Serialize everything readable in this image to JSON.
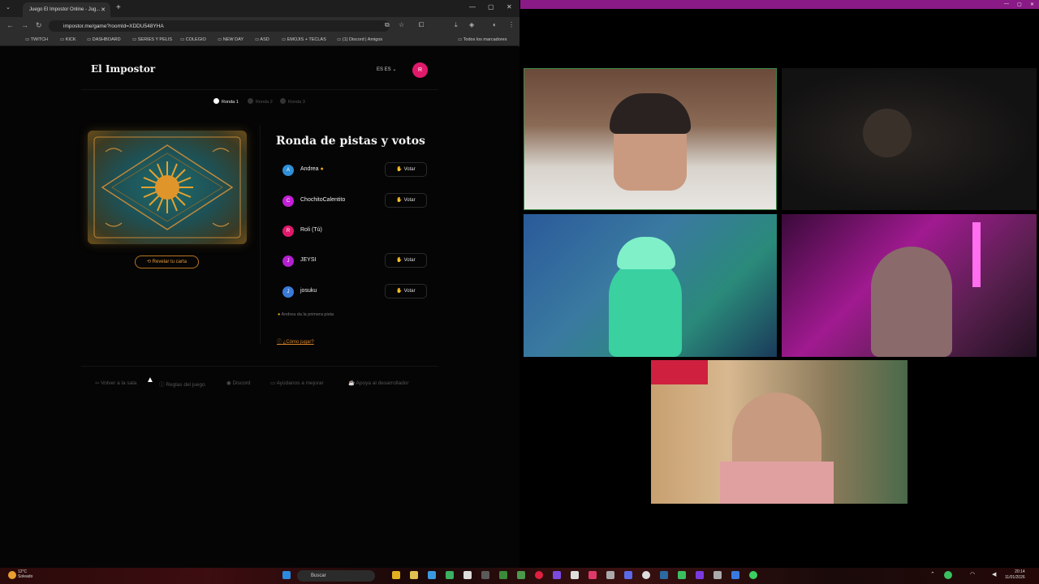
{
  "browser": {
    "tab_title": "Juego El Impostor Online - Jug...",
    "url": "impostor.me/game?roomId=XDDU548YHA",
    "bookmarks": [
      "TWITCH",
      "KICK",
      "DASHBOARD",
      "SERIES Y PELIS",
      "COLEGIO",
      "NEW DAY",
      "ASD",
      "EMOJIS + TECLAS",
      "(1) Discord | Amigos",
      "Todos los marcadores"
    ]
  },
  "app": {
    "logo": "El Impostor",
    "lang": "ES ES",
    "avatar_initial": "R",
    "rounds": [
      "Ronda 1",
      "Ronda 2",
      "Ronda 3"
    ],
    "reveal_label": "Revelar tu carta",
    "section_title": "Ronda de pistas y votos",
    "vote_label": "Votar",
    "players": [
      {
        "initial": "A",
        "name": "Andrea",
        "color": "#2f8fd8",
        "turn": true,
        "can_vote": true
      },
      {
        "initial": "C",
        "name": "ChochitoCalentito",
        "color": "#c41fd8",
        "turn": false,
        "can_vote": true
      },
      {
        "initial": "R",
        "name": "Roli (Tú)",
        "color": "#e0196b",
        "turn": false,
        "can_vote": false
      },
      {
        "initial": "J",
        "name": "JEYSI",
        "color": "#b41fd0",
        "turn": false,
        "can_vote": true
      },
      {
        "initial": "J",
        "name": "josuku",
        "color": "#3a7ad8",
        "turn": false,
        "can_vote": true
      }
    ],
    "hint": "Andrea da la primera pista",
    "howto": "¿Cómo jugar?",
    "footer": [
      "Volver a la sala",
      "Reglas del juego",
      "Discord",
      "Ayúdanos a mejorar",
      "Apoya al desarrollador"
    ]
  },
  "taskbar": {
    "weather_temp": "12°C",
    "weather_desc": "Soleado",
    "search": "Buscar",
    "time": "20:14",
    "date": "11/01/2026"
  }
}
